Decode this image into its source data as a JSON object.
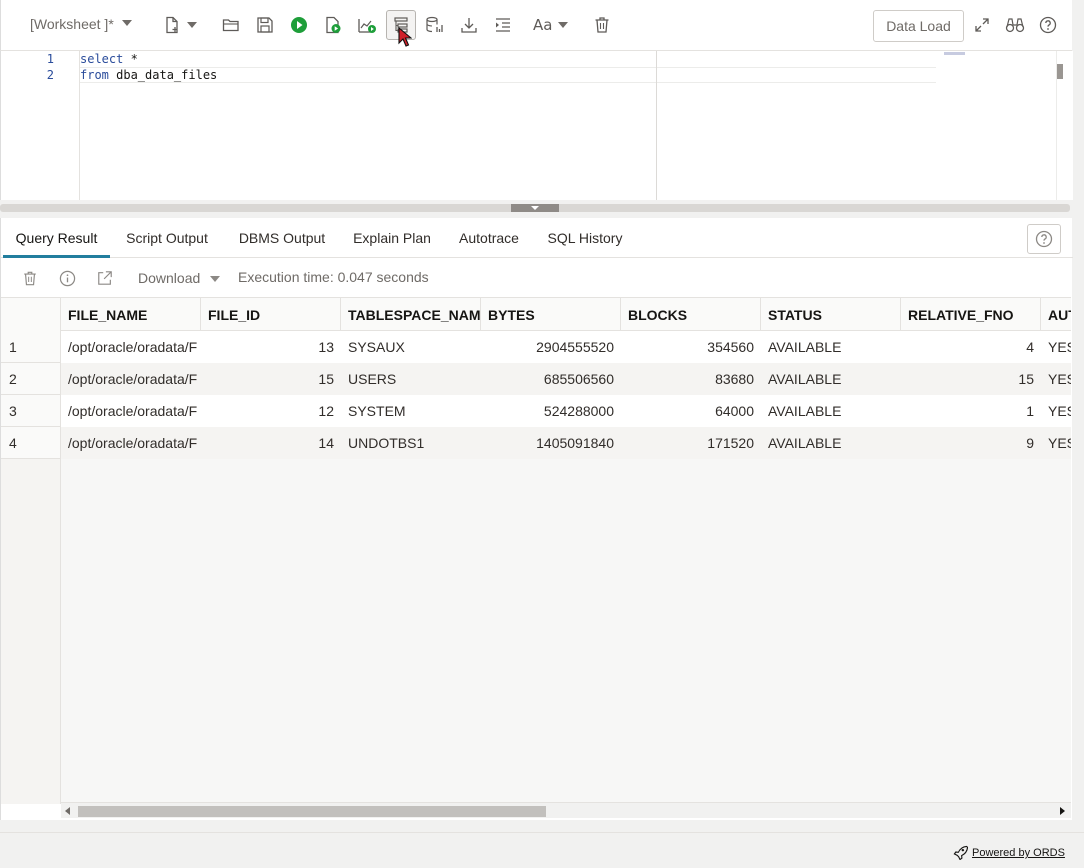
{
  "toolbar": {
    "worksheet_title": "[Worksheet ]*",
    "icons": [
      "new-file-icon",
      "open-folder-icon",
      "save-icon",
      "run-statement-icon",
      "run-script-icon",
      "autotrace-icon",
      "explain-plan-icon",
      "sql-history-icon",
      "download-icon",
      "format-icon",
      "font-size-icon",
      "trash-icon"
    ],
    "font_size_label": "Aa",
    "data_load_label": "Data Load"
  },
  "editor": {
    "lines": [
      {
        "number": "1",
        "keyword": "select",
        "rest": " *"
      },
      {
        "number": "2",
        "keyword": "from",
        "rest": " dba_data_files"
      }
    ]
  },
  "result": {
    "tabs": [
      {
        "label": "Query Result",
        "active": true
      },
      {
        "label": "Script Output",
        "active": false
      },
      {
        "label": "DBMS Output",
        "active": false
      },
      {
        "label": "Explain Plan",
        "active": false
      },
      {
        "label": "Autotrace",
        "active": false
      },
      {
        "label": "SQL History",
        "active": false
      }
    ],
    "download_label": "Download",
    "execution_time": "Execution time: 0.047 seconds"
  },
  "grid": {
    "columns": [
      "FILE_NAME",
      "FILE_ID",
      "TABLESPACE_NAME",
      "BYTES",
      "BLOCKS",
      "STATUS",
      "RELATIVE_FNO",
      "AUT"
    ],
    "rows": [
      {
        "rownum": "1",
        "file_name": "/opt/oracle/oradata/F",
        "file_id": "13",
        "tablespace_name": "SYSAUX",
        "bytes": "2904555520",
        "blocks": "354560",
        "status": "AVAILABLE",
        "relative_fno": "4",
        "aut": "YES"
      },
      {
        "rownum": "2",
        "file_name": "/opt/oracle/oradata/F",
        "file_id": "15",
        "tablespace_name": "USERS",
        "bytes": "685506560",
        "blocks": "83680",
        "status": "AVAILABLE",
        "relative_fno": "15",
        "aut": "YES"
      },
      {
        "rownum": "3",
        "file_name": "/opt/oracle/oradata/F",
        "file_id": "12",
        "tablespace_name": "SYSTEM",
        "bytes": "524288000",
        "blocks": "64000",
        "status": "AVAILABLE",
        "relative_fno": "1",
        "aut": "YES"
      },
      {
        "rownum": "4",
        "file_name": "/opt/oracle/oradata/F",
        "file_id": "14",
        "tablespace_name": "UNDOTBS1",
        "bytes": "1405091840",
        "blocks": "171520",
        "status": "AVAILABLE",
        "relative_fno": "9",
        "aut": "YES"
      }
    ]
  },
  "footer": {
    "powered_by": "Powered by ORDS"
  },
  "colors": {
    "accent_tab": "#227e9e",
    "run_green": "#1e9e3a",
    "keyword_blue": "#2a4c9b",
    "cursor_red": "#d0202a"
  }
}
